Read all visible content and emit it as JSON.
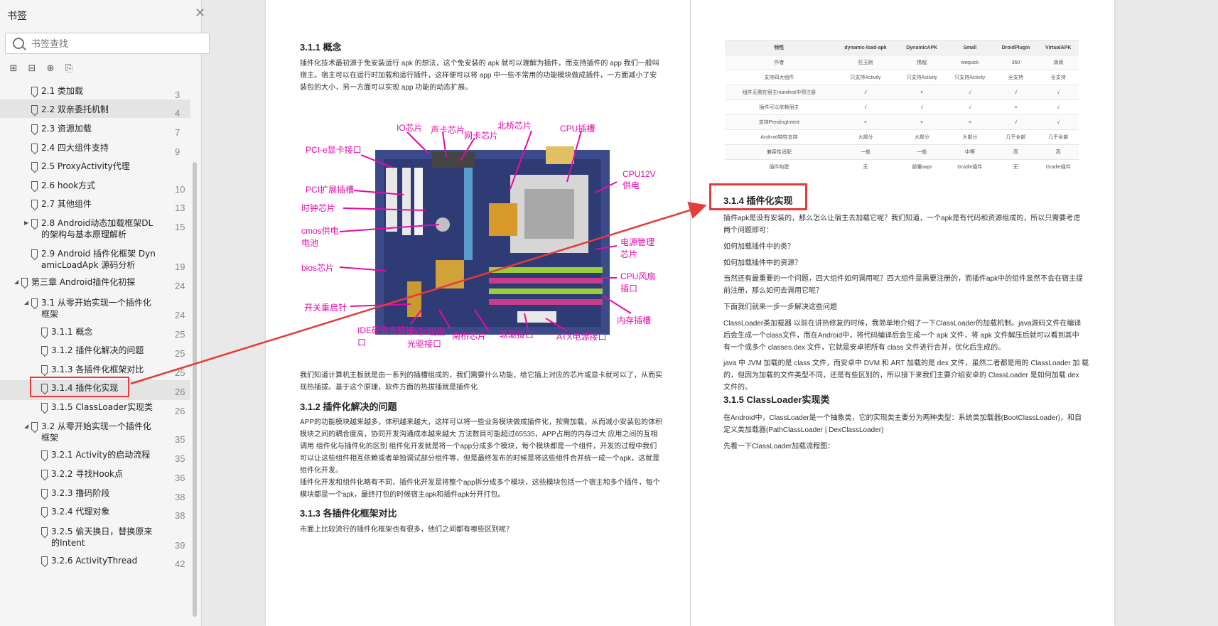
{
  "sidebar": {
    "title": "书签",
    "search_placeholder": "书签查找",
    "items": [
      {
        "label": "2.1 类加载",
        "page": "3"
      },
      {
        "label": "2.2 双亲委托机制",
        "page": "4"
      },
      {
        "label": "2.3 资源加载",
        "page": "7"
      },
      {
        "label": "2.4 四大组件支持",
        "page": "9"
      },
      {
        "label": "2.5 ProxyActivity代理",
        "page": "10"
      },
      {
        "label": "2.6 hook方式",
        "page": "10"
      },
      {
        "label": "2.7 其他组件",
        "page": "13"
      },
      {
        "label": "2.8 Android动态加载框架DL\n的架构与基本原理解析",
        "page": "15"
      },
      {
        "label": "2.9 Android 插件化框架 Dyn\namicLoadApk 源码分析",
        "page": "19"
      },
      {
        "label": "第三章 Android插件化初探",
        "page": "24"
      },
      {
        "label": "3.1 从零开始实现一个插件化\n框架",
        "page": "24"
      },
      {
        "label": "3.1.1 概念",
        "page": "25"
      },
      {
        "label": "3.1.2 插件化解决的问题",
        "page": "25"
      },
      {
        "label": "3.1.3 各插件化框架对比",
        "page": "25"
      },
      {
        "label": "3.1.4 插件化实现",
        "page": "26"
      },
      {
        "label": "3.1.5 ClassLoader实现类",
        "page": "26"
      },
      {
        "label": "3.2 从零开始实现一个插件化\n框架",
        "page": "35"
      },
      {
        "label": "3.2.1 Activity的启动流程",
        "page": "35"
      },
      {
        "label": "3.2.2 寻找Hook点",
        "page": "36"
      },
      {
        "label": "3.2.3 撸码阶段",
        "page": "38"
      },
      {
        "label": "3.2.4 代理对象",
        "page": "38"
      },
      {
        "label": "3.2.5 偷天换日，替换原来\n的Intent",
        "page": "39"
      },
      {
        "label": "3.2.6 ActivityThread",
        "page": "42"
      }
    ]
  },
  "left_page": {
    "h_311": "3.1.1 概念",
    "p_311_1": "插件化技术最初源于免安装运行 apk 的想法，这个免安装的 apk 就可以理解为插件，而支持插件的 app 我们一般叫",
    "p_311_2": "宿主。宿主可以在运行时加载和运行插件，这样便可以将 app 中一些不常用的功能模块做成插件，一方面减小了安",
    "p_311_3": "装包的大小，另一方面可以实现 app 功能的动态扩展。",
    "motherboard_labels": [
      "IO芯片",
      "声卡芯片",
      "网卡芯片",
      "北桥芯片",
      "CPU插槽",
      "PCI-e显卡接口",
      "CPU12V供电",
      "PCI扩展插槽",
      "时钟芯片",
      "cmos供电电池",
      "电源管理芯片",
      "bios芯片",
      "CPU风扇插口",
      "开关重启针",
      "内存插槽",
      "IDE硬盘光驱接口",
      "SATA硬盘光驱接口",
      "南桥芯片",
      "软驱接口",
      "ATX电源接口"
    ],
    "p_after_1": "我们知道计算机主板就是由一系列的插槽组成的，我们需要什么功能，给它插上对应的芯片或显卡就可以了，从而实",
    "p_after_2": "现热插拔。基于这个原理，软件方面的热拔插就是插件化",
    "h_312": "3.1.2 插件化解决的问题",
    "p_312_1": "APP的功能模块越来越多，体积越来越大，这样可以将一些业务模块做成插件化，按需加载，从而减小安装包的体积",
    "p_312_2": "模块之间的耦合度高，协同开发沟通成本越来越大 方法数目可能超过65535，APP占用的内存过大 应用之间的互相",
    "p_312_3": "调用 组件化与插件化的区别 组件化开发就是将一个app分成多个模块，每个模块都是一个组件，开发的过程中我们",
    "p_312_4": "可以让这些组件相互依赖或者单独调试部分组件等，但是最终发布的时候是将这些组件合并统一成一个apk，这就是",
    "p_312_5": "组件化开发。",
    "p_312_6": "插件化开发和组件化略有不同，插件化开发是将整个app拆分成多个模块，这些模块包括一个宿主和多个插件，每个",
    "p_312_7": "模块都是一个apk，最终打包的时候宿主apk和插件apk分开打包。",
    "h_313": "3.1.3 各插件化框架对比",
    "p_313_1": "市面上比较流行的插件化框架也有很多，他们之间都有哪些区别呢？"
  },
  "right_page": {
    "table": {
      "header": [
        "特性",
        "dynamic-load-apk",
        "DynamicAPK",
        "Small",
        "DroidPlugin",
        "VirtualAPK"
      ],
      "rows": [
        [
          "作者",
          "任玉刚",
          "携程",
          "wequick",
          "360",
          "滴滴"
        ],
        [
          "支持四大组件",
          "只支持Activity",
          "只支持Activity",
          "只支持Activity",
          "全支持",
          "全支持"
        ],
        [
          "组件无需在宿主manifest中预注册",
          "√",
          "×",
          "√",
          "√",
          "√"
        ],
        [
          "插件可以依赖宿主",
          "√",
          "√",
          "√",
          "×",
          "√"
        ],
        [
          "支持PendingIntent",
          "×",
          "×",
          "×",
          "√",
          "√"
        ],
        [
          "Android特性支持",
          "大部分",
          "大部分",
          "大部分",
          "几乎全部",
          "几乎全部"
        ],
        [
          "兼容性适配",
          "一般",
          "一般",
          "中等",
          "高",
          "高"
        ],
        [
          "插件构建",
          "无",
          "部署aapt",
          "Gradle插件",
          "无",
          "Gradle插件"
        ]
      ]
    },
    "h_314": "3.1.4 插件化实现",
    "p_314_1": "插件apk是没有安装的，那么怎么让宿主去加载它呢？我们知道，一个apk是有代码和资源组成的，所以只需要考虑",
    "p_314_2": "两个问题即可：",
    "p_314_3": "如何加载插件中的类？",
    "p_314_4": "如何加载插件中的资源？",
    "p_314_5": "当然还有最重要的一个问题，四大组件如何调用呢？四大组件是需要注册的，而插件apk中的组件显然不会在宿主提",
    "p_314_6": "前注册，那么如何去调用它呢？",
    "p_314_7": "下面我们就来一步一步解决这些问题",
    "p_314_8": "ClassLoader类加载器 以前在讲热修复的时候，我简单地介绍了一下ClassLoader的加载机制。java源码文件在编译",
    "p_314_9": "后会生成一个class文件，而在Android中，将代码编译后会生成一个 apk 文件，将 apk 文件解压后就可以看到其中",
    "p_314_10": "有一个或多个 classes.dex 文件，它就是安卓把所有 class 文件进行合并，优化后生成的。",
    "p_314_11": "java 中 JVM 加载的是 class 文件，而安卓中 DVM 和 ART 加载的是 dex 文件，虽然二者都是用的 ClassLoader 加 载",
    "p_314_12": "的，但因为加载的文件类型不同，还是有些区别的，所以接下来我们主要介绍安卓的 ClassLoader 是如何加载 dex",
    "p_314_13": "文件的。",
    "h_315": "3.1.5 ClassLoader实现类",
    "p_315_1": "在Android中，ClassLoader是一个抽象类，它的实现类主要分为两种类型：系统类加载器(BootClassLoader)，和自",
    "p_315_2": "定义类加载器(PathClassLoader | DexClassLoader)",
    "p_315_3": "先看一下ClassLoader加载流程图："
  },
  "colors": {
    "highlight": "#e53b3b",
    "label_magenta": "#e60aa8"
  }
}
